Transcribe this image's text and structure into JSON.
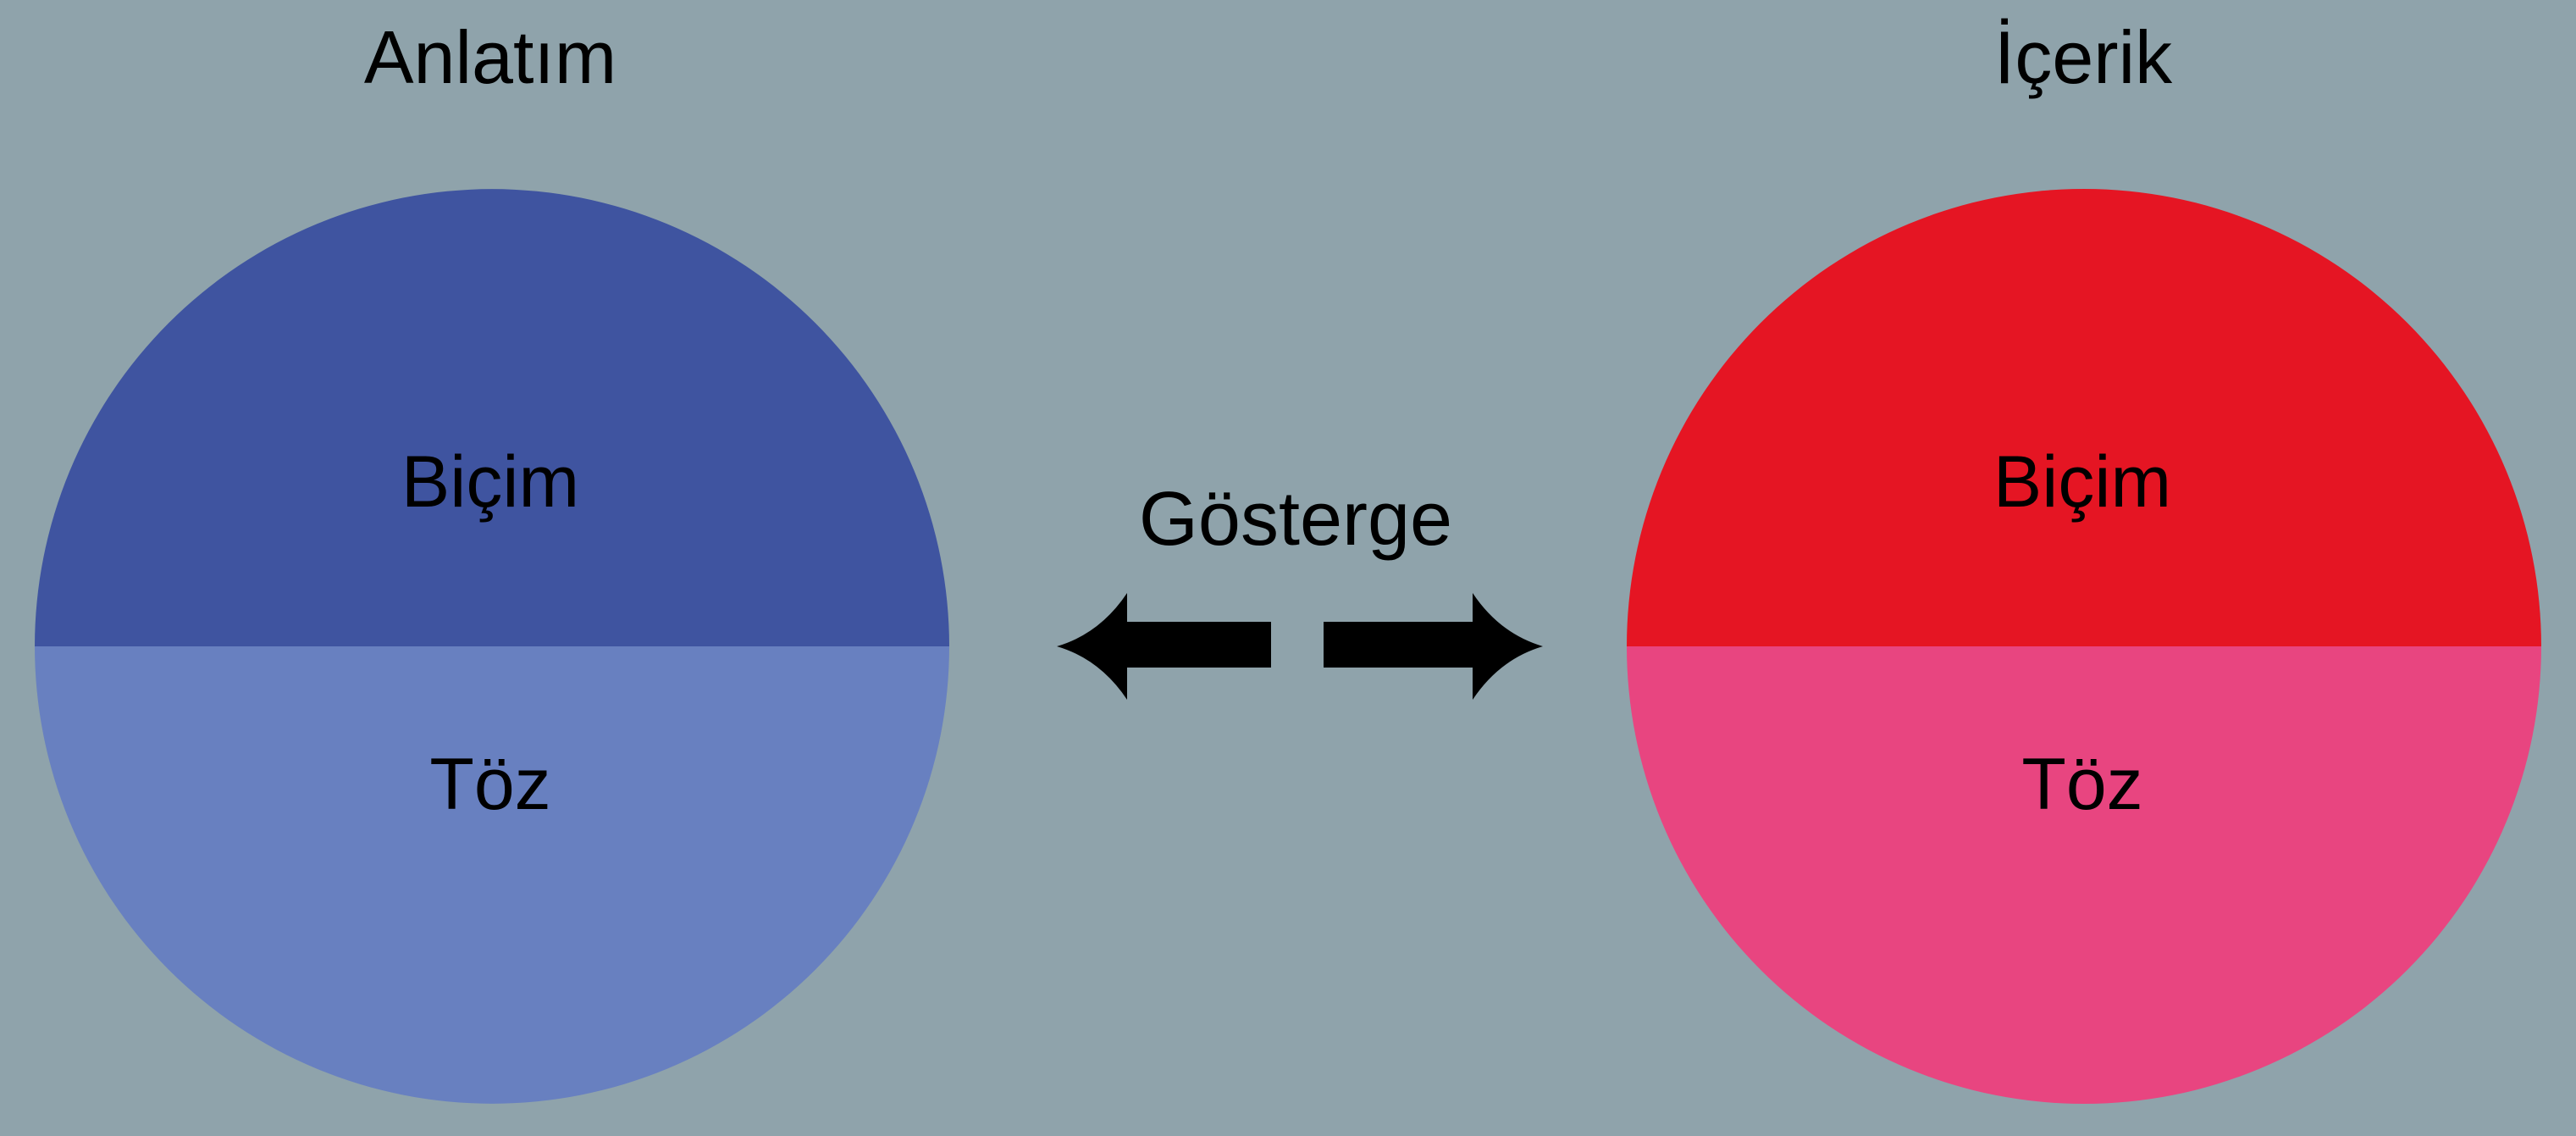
{
  "diagram": {
    "left_title": "Anlatım",
    "right_title": "İçerik",
    "center_label": "Gösterge",
    "left_circle": {
      "top_label": "Biçim",
      "bottom_label": "Töz",
      "top_color": "#3f54a0",
      "bottom_color": "#6880c0"
    },
    "right_circle": {
      "top_label": "Biçim",
      "bottom_label": "Töz",
      "top_color": "#e51523",
      "bottom_color": "#e84580"
    },
    "background_color": "#8fa3ab",
    "arrow_color": "#000000",
    "arrows": [
      "left-arrow",
      "right-arrow"
    ]
  }
}
